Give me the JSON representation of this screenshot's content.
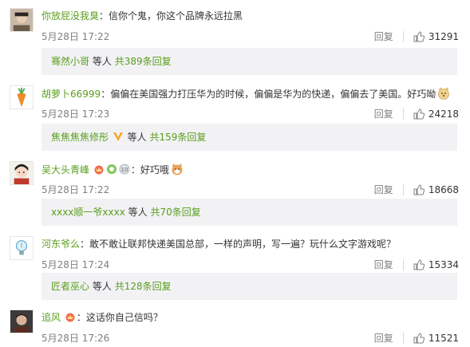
{
  "comments": [
    {
      "user": "你放屁没我臭",
      "text": "：信你个鬼，你这个品牌永远拉黑",
      "time": "5月28日 17:22",
      "reply": "回复",
      "likes": "31291",
      "sub": {
        "name": "骞然小哥",
        "mid": "等人",
        "more": "共389条回复"
      }
    },
    {
      "user": "胡萝卜66999",
      "text": "：偏偏在美国强力打压华为的时候，偏偏是华为的快递，偏偏去了美国。好巧呦",
      "time": "5月28日 17:23",
      "reply": "回复",
      "likes": "24218",
      "sub": {
        "name": "焦焦焦焦修彤",
        "mid": "等人",
        "more": "共159条回复"
      }
    },
    {
      "user": "吴大头青峰",
      "text": "：好巧哦",
      "time": "5月28日 17:22",
      "reply": "回复",
      "likes": "18668",
      "sub": {
        "name": "xxxx顺一爷xxxx",
        "mid": "等人",
        "more": "共70条回复"
      }
    },
    {
      "user": "河东爷么",
      "text": "：敢不敢让联邦快递美国总部，一样的声明，写一遍？玩什么文字游戏呢？",
      "time": "5月28日 17:24",
      "reply": "回复",
      "likes": "15334",
      "sub": {
        "name": "匠者巫心",
        "mid": "等人",
        "more": "共128条回复"
      }
    },
    {
      "user": "追风",
      "text": "：这话你自己信吗？",
      "time": "5月28日 17:26",
      "reply": "回复",
      "likes": "11521"
    }
  ],
  "colors": {
    "username": "#eb7350",
    "subbox_bg": "#f2f2f5",
    "meta": "#808080"
  }
}
